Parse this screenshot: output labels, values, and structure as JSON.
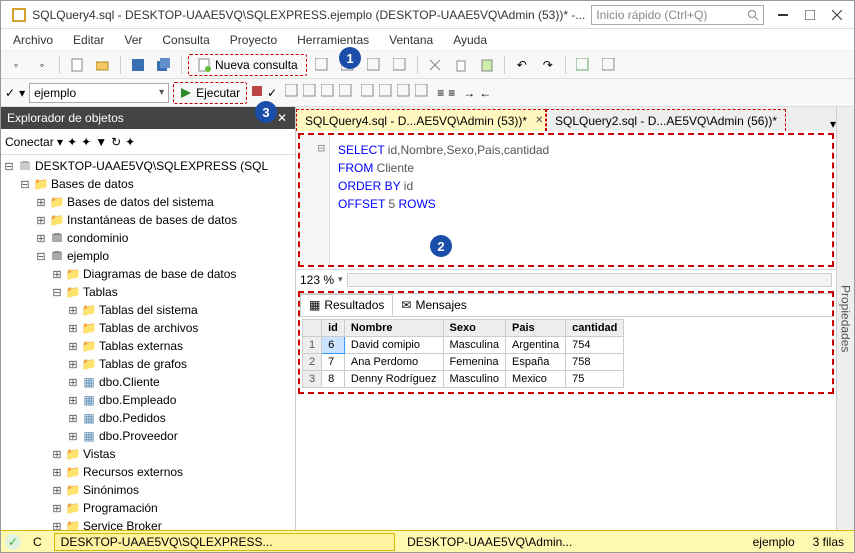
{
  "titlebar": {
    "title": "SQLQuery4.sql - DESKTOP-UAAE5VQ\\SQLEXPRESS.ejemplo (DESKTOP-UAAE5VQ\\Admin (53))* -...",
    "quick_launch_placeholder": "Inicio rápido (Ctrl+Q)"
  },
  "menu": [
    "Archivo",
    "Editar",
    "Ver",
    "Consulta",
    "Proyecto",
    "Herramientas",
    "Ventana",
    "Ayuda"
  ],
  "toolbar": {
    "nueva_consulta": "Nueva consulta"
  },
  "toolbar2": {
    "database": "ejemplo",
    "ejecutar": "Ejecutar",
    "zoom": "123 %"
  },
  "callouts": {
    "n1": "1",
    "n2": "2",
    "n3": "3"
  },
  "explorer": {
    "title": "Explorador de objetos",
    "conectar": "Conectar",
    "tree": {
      "server": "DESKTOP-UAAE5VQ\\SQLEXPRESS (SQL",
      "bases": "Bases de datos",
      "bases_sistema": "Bases de datos del sistema",
      "instantaneas": "Instantáneas de bases de datos",
      "condo": "condominio",
      "ejemplo": "ejemplo",
      "diagr": "Diagramas de base de datos",
      "tablas": "Tablas",
      "tablas_sistema": "Tablas del sistema",
      "tablas_archivos": "Tablas de archivos",
      "tablas_externas": "Tablas externas",
      "tablas_grafos": "Tablas de grafos",
      "t_cliente": "dbo.Cliente",
      "t_empleado": "dbo.Empleado",
      "t_pedidos": "dbo.Pedidos",
      "t_proveedor": "dbo.Proveedor",
      "vistas": "Vistas",
      "recursos": "Recursos externos",
      "sinonimos": "Sinónimos",
      "programacion": "Programación",
      "sbroker": "Service Broker"
    }
  },
  "tabs": {
    "t1": "SQLQuery4.sql - D...AE5VQ\\Admin (53))*",
    "t2": "SQLQuery2.sql - D...AE5VQ\\Admin (56))*"
  },
  "editor": {
    "l1a": "SELECT",
    "l1b": " id,Nombre,Sexo,Pais,cantidad",
    "l2a": "FROM",
    "l2b": " Cliente",
    "l3a": "ORDER BY",
    "l3b": " id",
    "l4a": "OFFSET",
    "l4b": " 5 ",
    "l4c": "ROWS"
  },
  "result_tabs": {
    "resultados": "Resultados",
    "mensajes": "Mensajes"
  },
  "grid": {
    "cols": [
      "id",
      "Nombre",
      "Sexo",
      "Pais",
      "cantidad"
    ],
    "rows": [
      {
        "n": "1",
        "id": "6",
        "nombre": "David comipio",
        "sexo": "Masculina",
        "pais": "Argentina",
        "cant": "754"
      },
      {
        "n": "2",
        "id": "7",
        "nombre": "Ana Perdomo",
        "sexo": "Femenina",
        "pais": "España",
        "cant": "758"
      },
      {
        "n": "3",
        "id": "8",
        "nombre": "Denny Rodríguez",
        "sexo": "Masculino",
        "pais": "Mexico",
        "cant": "75"
      }
    ]
  },
  "status": {
    "c": "C",
    "conn": "DESKTOP-UAAE5VQ\\SQLEXPRESS...",
    "user": "DESKTOP-UAAE5VQ\\Admin...",
    "db": "ejemplo",
    "rows": "3 filas"
  },
  "vstrip": "Propiedades"
}
